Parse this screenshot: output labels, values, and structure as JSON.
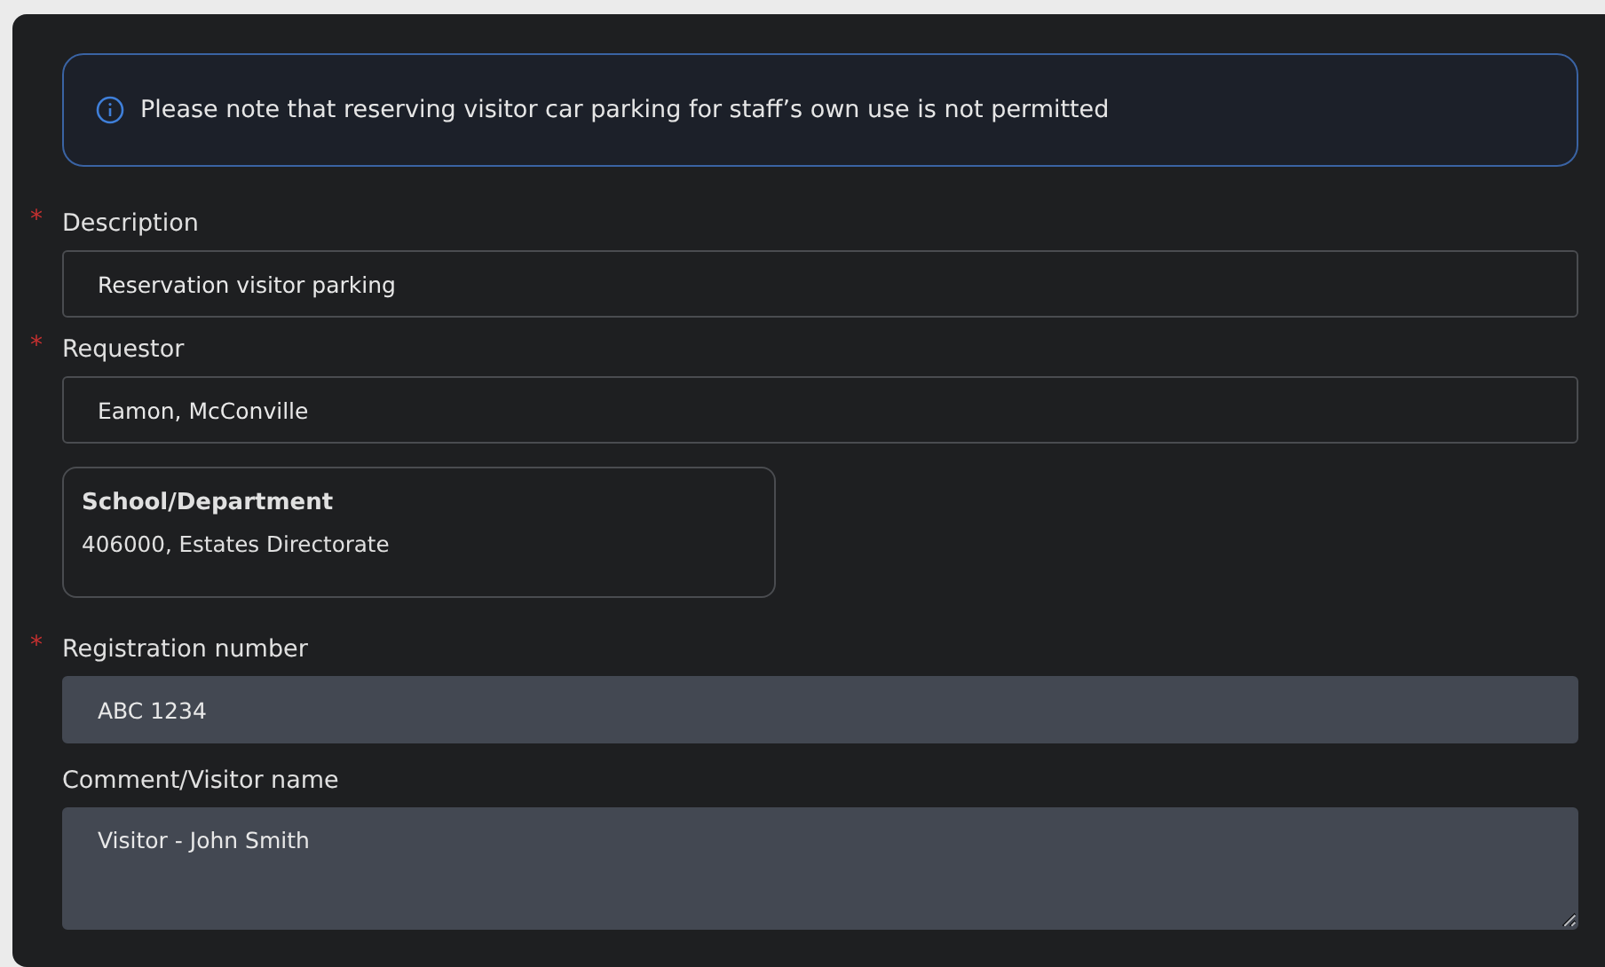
{
  "notice": {
    "text": "Please note that reserving visitor car parking for staff’s own use is not permitted"
  },
  "fields": [
    {
      "label": "Description",
      "required_mark": "*",
      "kind": "outlined",
      "value": "Reservation visitor parking"
    },
    {
      "label": "Requestor",
      "required_mark": "*",
      "kind": "outlined",
      "value": "Eamon, McConville",
      "popover": {
        "title": "School/Department",
        "text": "406000, Estates Directorate"
      }
    },
    {
      "label": "Registration number",
      "required_mark": "*",
      "kind": "filled",
      "value": "ABC 1234"
    },
    {
      "label": "Comment/Visitor name",
      "kind": "textarea",
      "value": "Visitor - John Smith"
    }
  ]
}
